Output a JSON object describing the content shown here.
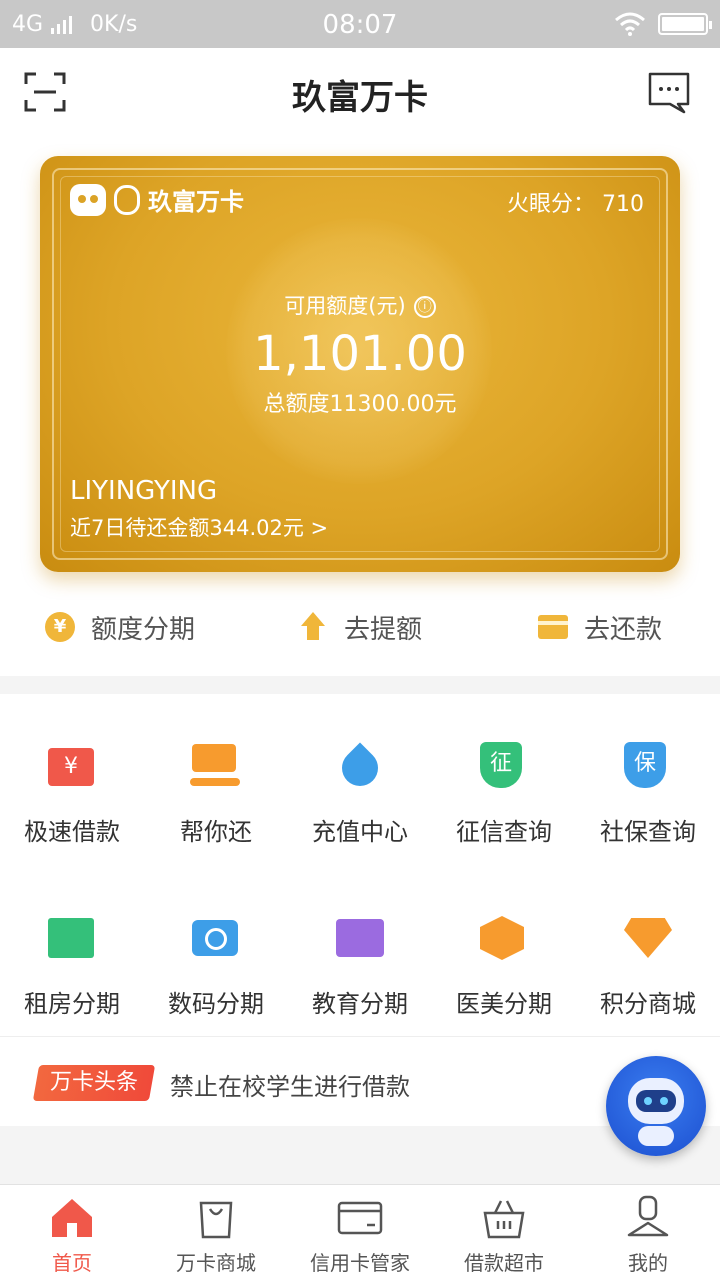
{
  "statusbar": {
    "network": "4G",
    "speed": "0K/s",
    "time": "08:07"
  },
  "header": {
    "title": "玖富万卡"
  },
  "card": {
    "brand": "玖富万卡",
    "score_label": "火眼分：",
    "score": "710",
    "available_label": "可用额度(元)",
    "info_icon": "ⓘ",
    "available_amount": "1,101.00",
    "total": "总额度11300.00元",
    "name": "LIYINGYING",
    "due": "近7日待还金额344.02元 >"
  },
  "quick": [
    {
      "label": "额度分期",
      "icon": "yen-coin-icon"
    },
    {
      "label": "去提额",
      "icon": "arrow-up-icon"
    },
    {
      "label": "去还款",
      "icon": "card-icon"
    }
  ],
  "services": {
    "row1": [
      {
        "label": "极速借款",
        "icon": "yen-note-icon",
        "glyph": "¥"
      },
      {
        "label": "帮你还",
        "icon": "hand-card-icon",
        "glyph": ""
      },
      {
        "label": "充值中心",
        "icon": "water-drop-icon",
        "glyph": ""
      },
      {
        "label": "征信查询",
        "icon": "credit-shield-icon",
        "glyph": "征"
      },
      {
        "label": "社保查询",
        "icon": "social-shield-icon",
        "glyph": "保"
      }
    ],
    "row2": [
      {
        "label": "租房分期",
        "icon": "building-icon"
      },
      {
        "label": "数码分期",
        "icon": "camera-icon"
      },
      {
        "label": "教育分期",
        "icon": "book-icon"
      },
      {
        "label": "医美分期",
        "icon": "syringe-icon"
      },
      {
        "label": "积分商城",
        "icon": "diamond-icon"
      }
    ]
  },
  "news": {
    "tag": "万卡头条",
    "text": "禁止在校学生进行借款"
  },
  "tabs": [
    {
      "label": "首页",
      "icon": "home-icon",
      "active": true
    },
    {
      "label": "万卡商城",
      "icon": "shopping-bag-icon"
    },
    {
      "label": "信用卡管家",
      "icon": "credit-card-icon"
    },
    {
      "label": "借款超市",
      "icon": "basket-icon"
    },
    {
      "label": "我的",
      "icon": "user-icon"
    }
  ],
  "colors": {
    "accent_gold": "#dda426",
    "active_red": "#f0584a",
    "icon_orange": "#f0b63a"
  }
}
